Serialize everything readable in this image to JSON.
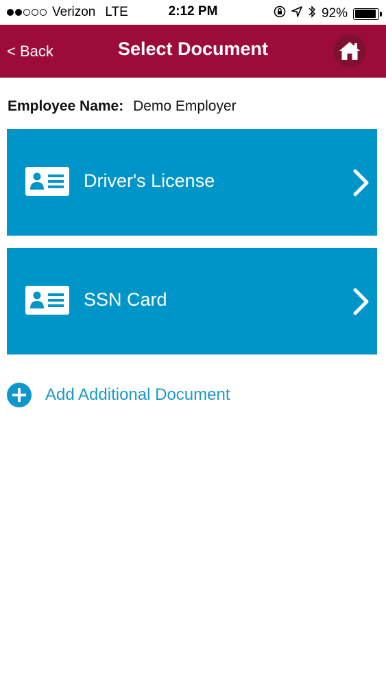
{
  "status_bar": {
    "carrier": "Verizon",
    "network": "LTE",
    "time": "2:12 PM",
    "battery_percent": "92%",
    "battery_level": 0.92,
    "signal_bars": 2,
    "icons": [
      "orientation-lock-icon",
      "location-arrow-icon",
      "bluetooth-icon",
      "battery-icon"
    ]
  },
  "nav": {
    "back_label": "< Back",
    "title": "Select Document",
    "home_icon": "home-icon"
  },
  "employee": {
    "label": "Employee Name:",
    "value": "Demo Employer"
  },
  "documents": [
    {
      "label": "Driver's License",
      "icon": "id-card-icon"
    },
    {
      "label": "SSN Card",
      "icon": "id-card-icon"
    }
  ],
  "add_document": {
    "label": "Add Additional Document",
    "icon": "plus-circle-icon"
  },
  "colors": {
    "nav_background": "#9c0c3a",
    "card_background": "#0095c8",
    "link": "#1b9ac9"
  }
}
